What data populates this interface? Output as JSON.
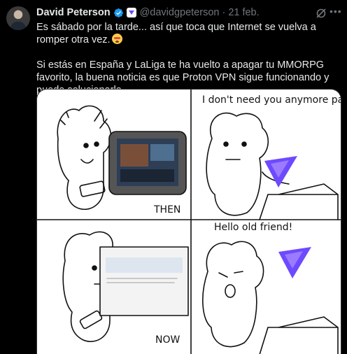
{
  "author": {
    "name": "David Peterson",
    "handle": "@davidgpeterson",
    "separator": "·",
    "date": "21 feb."
  },
  "tweet": {
    "paragraph1": "Es sábado por la tarde... así que toca que Internet se vuelva a romper otra vez.",
    "paragraph2": "Si estás en España y LaLiga te ha vuelto a apagar tu MMORPG favorito, la buena noticia es que Proton VPN sigue funcionando y puede solucionarlo."
  },
  "icons": {
    "verified": "verified-badge-icon",
    "affiliate": "proton-affiliate-icon",
    "emoji": "exploding-head-emoji",
    "grok": "grok-icon",
    "more": "more-icon"
  },
  "comic": {
    "speech_top": "I don't need you anymore pal.",
    "speech_bottom": "Hello old friend!",
    "label_then": "THEN",
    "label_now": "NOW"
  },
  "colors": {
    "background": "#000000",
    "verified_blue": "#1d9bf0",
    "muted_text": "#71767b",
    "proton_purple": "#6d4aff"
  }
}
